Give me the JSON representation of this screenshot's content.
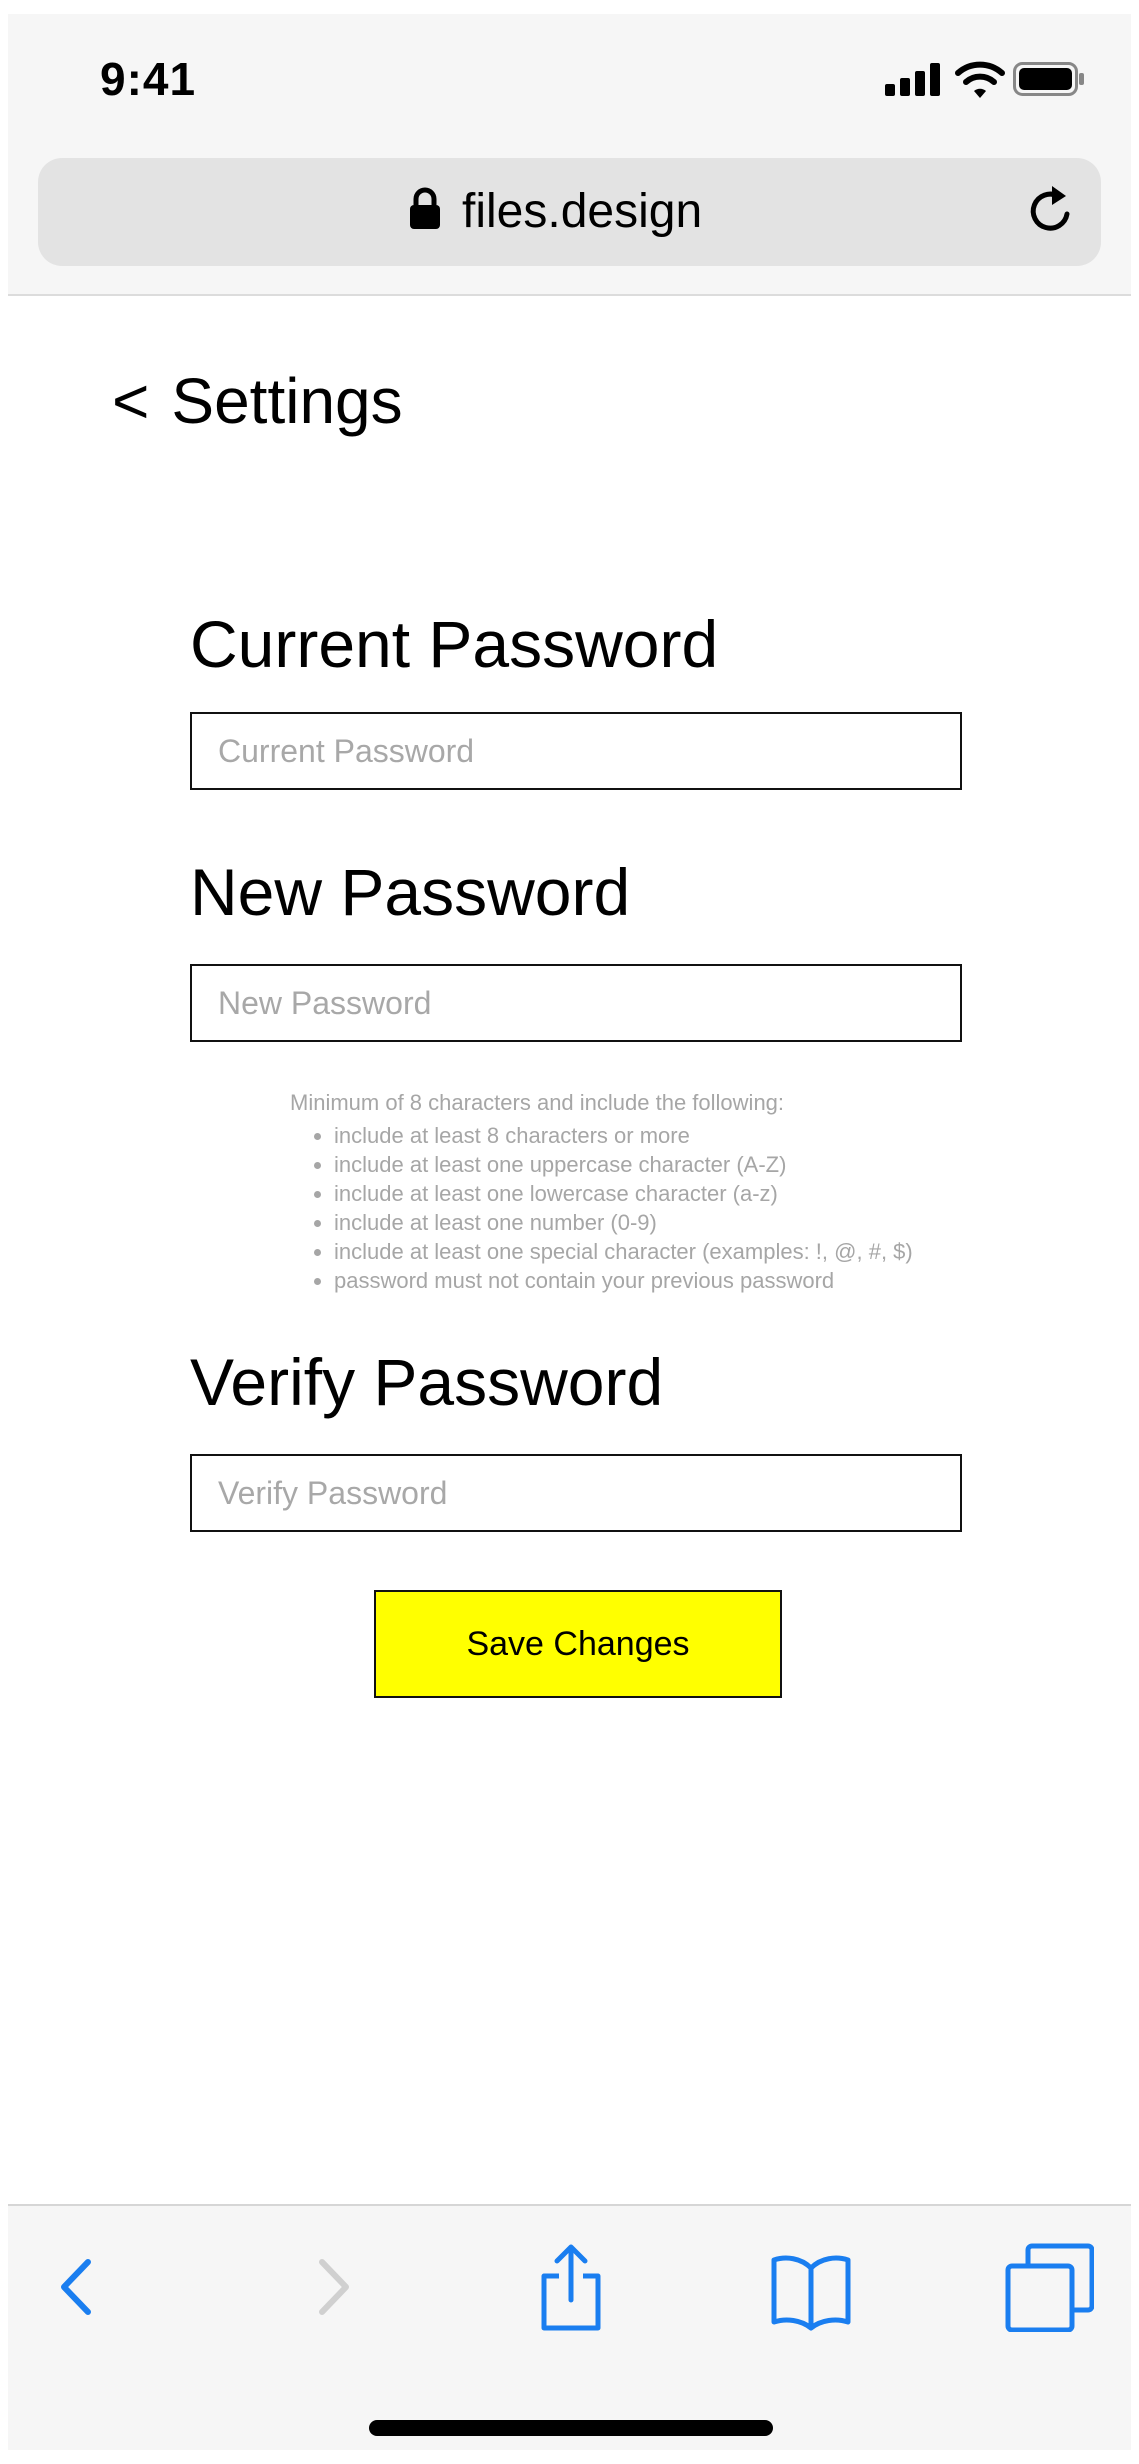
{
  "status_bar": {
    "time": "9:41"
  },
  "browser": {
    "url": "files.design"
  },
  "header": {
    "back_chevron": "<",
    "title": "Settings"
  },
  "form": {
    "current_password": {
      "label": "Current Password",
      "placeholder": "Current Password",
      "value": ""
    },
    "new_password": {
      "label": "New Password",
      "placeholder": "New Password",
      "value": ""
    },
    "rules": {
      "intro": "Minimum of 8 characters and include the following:",
      "items": [
        "include at least 8 characters or more",
        "include at least one uppercase character (A-Z)",
        "include at least one lowercase character (a-z)",
        "include at least one number (0-9)",
        "include at least one special character (examples: !, @, #, $)",
        "password must not contain your previous password"
      ]
    },
    "verify_password": {
      "label": "Verify Password",
      "placeholder": "Verify Password",
      "value": ""
    },
    "save_label": "Save Changes"
  },
  "toolbar": {
    "icons": [
      "back-icon",
      "forward-icon",
      "share-icon",
      "bookmarks-icon",
      "tabs-icon"
    ]
  },
  "colors": {
    "accent": "#1a7ef0",
    "button_bg": "#ffff00",
    "hint_text": "#a6a6a6",
    "chrome_bg": "#f6f6f6"
  }
}
